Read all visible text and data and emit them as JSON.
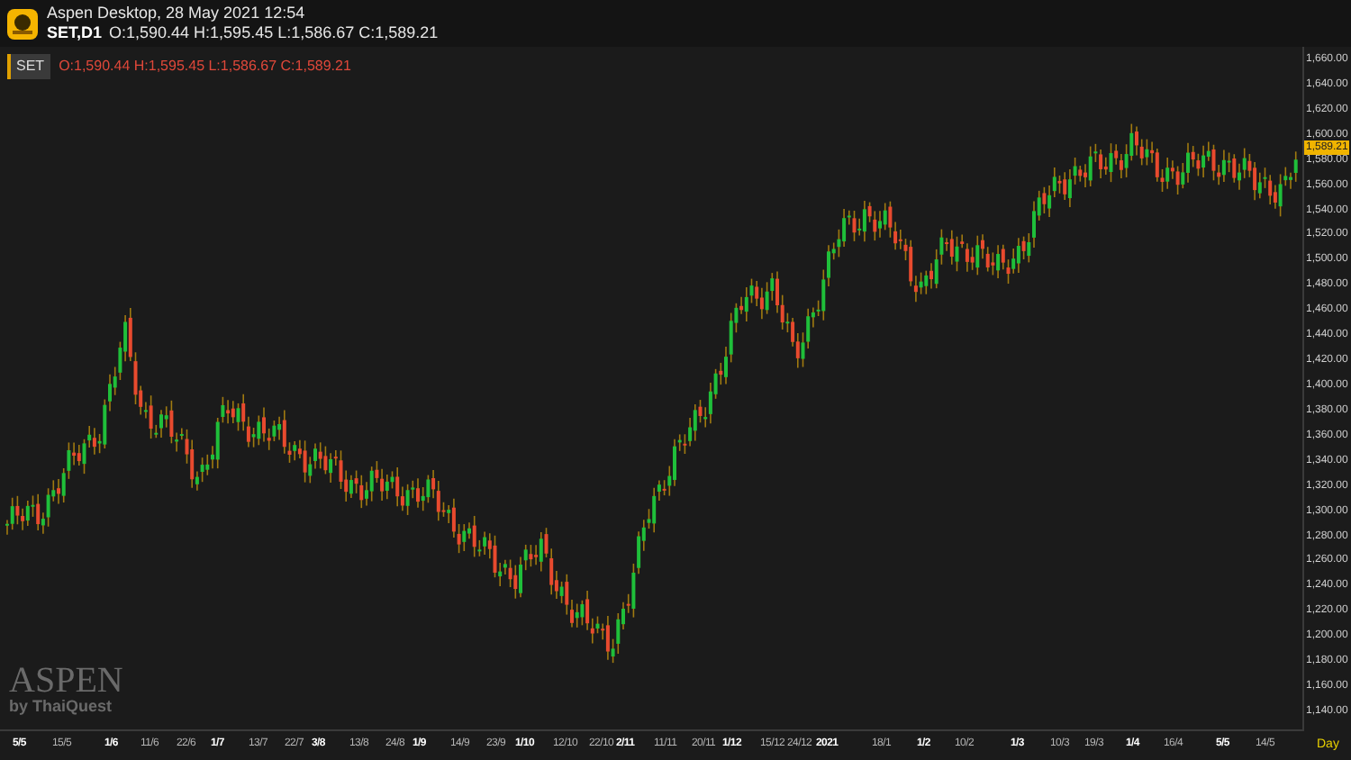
{
  "header": {
    "title": "Aspen Desktop, 28 May 2021 12:54",
    "symbol": "SET,D1",
    "ohlc": "O:1,590.44 H:1,595.45 L:1,586.67 C:1,589.21"
  },
  "legend": {
    "symbol": "SET",
    "ohlc": "O:1,590.44 H:1,595.45 L:1,586.67 C:1,589.21"
  },
  "price_axis": {
    "ticks": [
      "1,660.00",
      "1,640.00",
      "1,620.00",
      "1,600.00",
      "1,580.00",
      "1,560.00",
      "1,540.00",
      "1,520.00",
      "1,500.00",
      "1,480.00",
      "1,460.00",
      "1,440.00",
      "1,420.00",
      "1,400.00",
      "1,380.00",
      "1,360.00",
      "1,340.00",
      "1,320.00",
      "1,300.00",
      "1,280.00",
      "1,260.00",
      "1,240.00",
      "1,220.00",
      "1,200.00",
      "1,180.00",
      "1,160.00",
      "1,140.00"
    ],
    "last_price": "1,589.21"
  },
  "time_axis": {
    "ticks": [
      {
        "label": "5/5",
        "major": true
      },
      {
        "label": "15/5",
        "major": false
      },
      {
        "label": "1/6",
        "major": true
      },
      {
        "label": "11/6",
        "major": false
      },
      {
        "label": "22/6",
        "major": false
      },
      {
        "label": "1/7",
        "major": true
      },
      {
        "label": "13/7",
        "major": false
      },
      {
        "label": "22/7",
        "major": false
      },
      {
        "label": "3/8",
        "major": true
      },
      {
        "label": "13/8",
        "major": false
      },
      {
        "label": "24/8",
        "major": false
      },
      {
        "label": "1/9",
        "major": true
      },
      {
        "label": "14/9",
        "major": false
      },
      {
        "label": "23/9",
        "major": false
      },
      {
        "label": "1/10",
        "major": true
      },
      {
        "label": "12/10",
        "major": false
      },
      {
        "label": "22/10",
        "major": false
      },
      {
        "label": "2/11",
        "major": true
      },
      {
        "label": "11/11",
        "major": false
      },
      {
        "label": "20/11",
        "major": false
      },
      {
        "label": "1/12",
        "major": true
      },
      {
        "label": "15/12",
        "major": false
      },
      {
        "label": "24/12",
        "major": false
      },
      {
        "label": "2021",
        "major": true
      },
      {
        "label": "18/1",
        "major": false
      },
      {
        "label": "1/2",
        "major": true
      },
      {
        "label": "10/2",
        "major": false
      },
      {
        "label": "1/3",
        "major": true
      },
      {
        "label": "10/3",
        "major": false
      },
      {
        "label": "19/3",
        "major": false
      },
      {
        "label": "1/4",
        "major": true
      },
      {
        "label": "16/4",
        "major": false
      },
      {
        "label": "5/5",
        "major": true
      },
      {
        "label": "14/5",
        "major": false
      }
    ],
    "period": "Day"
  },
  "watermark": {
    "title": "ASPEN",
    "byline": "by ThaiQuest"
  }
}
